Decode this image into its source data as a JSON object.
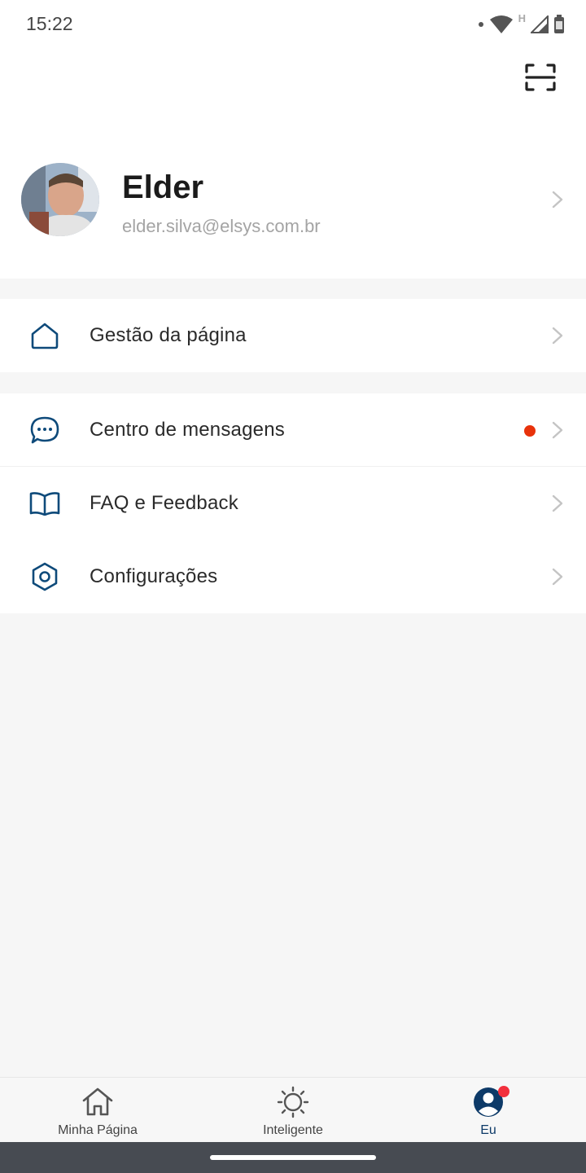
{
  "status_bar": {
    "time": "15:22",
    "network_label": "H",
    "battery_level": "90"
  },
  "header": {
    "scan_icon": "scan-icon"
  },
  "profile": {
    "name": "Elder",
    "email": "elder.silva@elsys.com.br",
    "avatar_icon": "avatar-photo"
  },
  "menu": {
    "groups": [
      {
        "items": [
          {
            "label": "Gestão da página",
            "icon": "home-outline-icon"
          }
        ]
      },
      {
        "items": [
          {
            "label": "Centro de mensagens",
            "icon": "chat-bubble-icon",
            "has_badge": true
          },
          {
            "label": "FAQ e Feedback",
            "icon": "book-open-icon"
          },
          {
            "label": "Configurações",
            "icon": "settings-hexagon-icon"
          }
        ]
      }
    ]
  },
  "bottom_nav": {
    "items": [
      {
        "label": "Minha Página",
        "icon": "home-icon",
        "active": false
      },
      {
        "label": "Inteligente",
        "icon": "sun-icon",
        "active": false
      },
      {
        "label": "Eu",
        "icon": "user-circle-icon",
        "active": true,
        "has_badge": true
      }
    ]
  },
  "colors": {
    "accent": "#0d3a68",
    "icon_blue": "#0e4a7a",
    "badge_red": "#e8320b",
    "nav_badge_red": "#f2303d",
    "chevron": "#c4c4c4",
    "page_background": "#f6f6f6"
  }
}
